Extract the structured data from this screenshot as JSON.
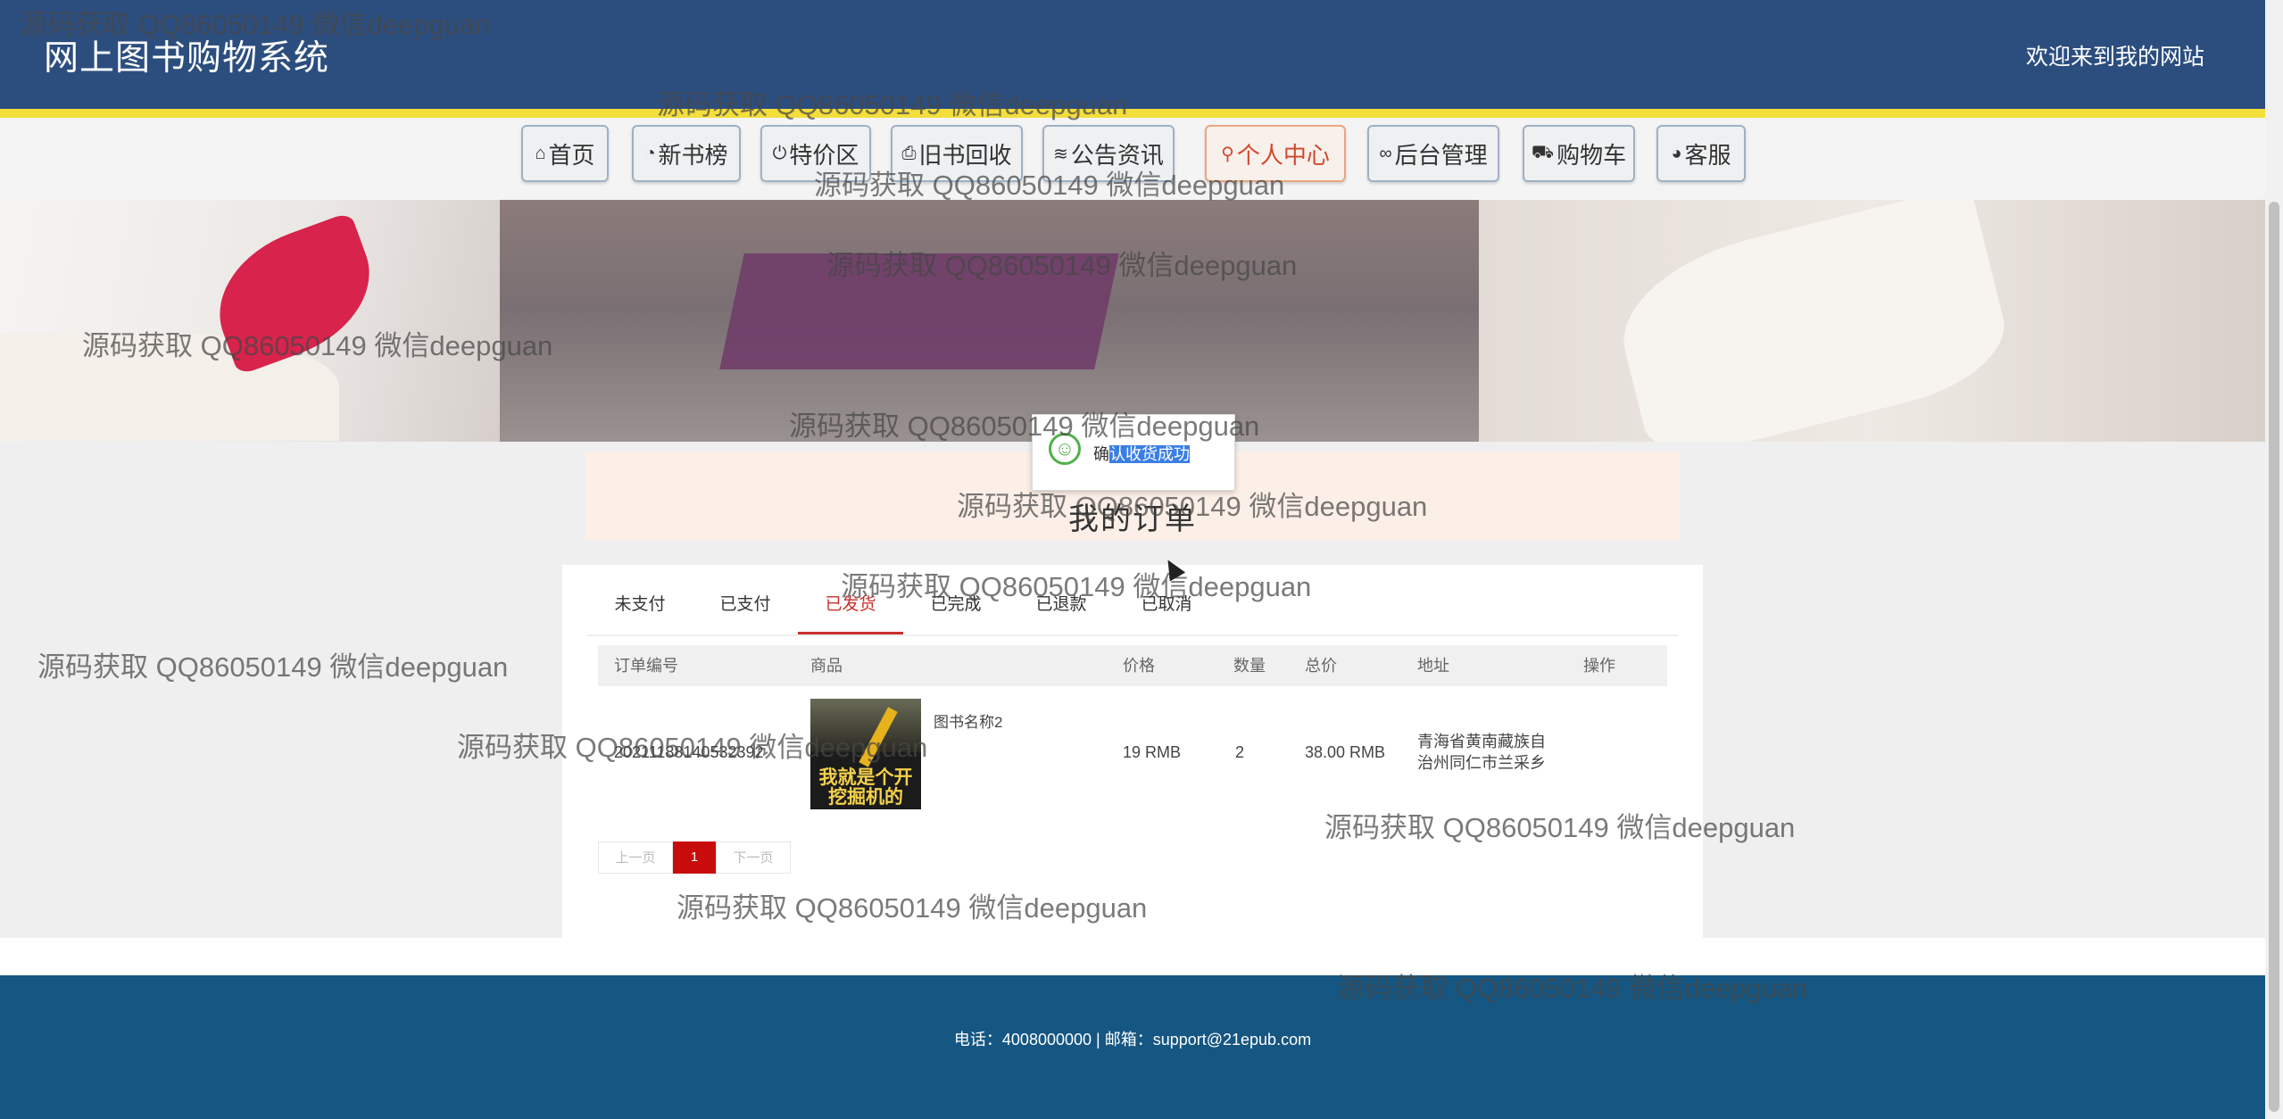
{
  "header": {
    "site_title": "网上图书购物系统",
    "welcome": "欢迎来到我的网站"
  },
  "nav": [
    {
      "icon": "home-icon",
      "glyph": "⌂",
      "label": "首页",
      "active": false
    },
    {
      "icon": "dashboard-icon",
      "glyph": "◔",
      "label": "新书榜",
      "active": false
    },
    {
      "icon": "power-icon",
      "glyph": "⏻",
      "label": "特价区",
      "active": false
    },
    {
      "icon": "printer-icon",
      "glyph": "⎙",
      "label": "旧书回收",
      "active": false
    },
    {
      "icon": "layers-icon",
      "glyph": "≋",
      "label": "公告资讯",
      "active": false
    },
    {
      "icon": "user-icon",
      "glyph": "⚲",
      "label": "个人中心",
      "active": true
    },
    {
      "icon": "link-icon",
      "glyph": "∞",
      "label": "后台管理",
      "active": false
    },
    {
      "icon": "cart-icon",
      "glyph": "⛟",
      "label": "购物车",
      "active": false
    },
    {
      "icon": "chat-icon",
      "glyph": "◕",
      "label": "客服",
      "active": false
    }
  ],
  "toast": {
    "prefix": "确",
    "selected": "认收货成功"
  },
  "page_title": "我的订单",
  "tabs": [
    "未支付",
    "已支付",
    "已发货",
    "已完成",
    "已退款",
    "已取消"
  ],
  "active_tab": "已发货",
  "table": {
    "headers": [
      "订单编号",
      "商品",
      "价格",
      "数量",
      "总价",
      "地址",
      "操作"
    ],
    "rows": [
      {
        "order_no": "20211188140532392",
        "product": "图书名称2",
        "cover_text": "我就是个开挖掘机的",
        "price": "19 RMB",
        "qty": "2",
        "total": "38.00 RMB",
        "address": [
          "青海省黄南藏族自",
          "治州同仁市兰采乡"
        ]
      }
    ]
  },
  "pager": {
    "prev": "上一页",
    "current": "1",
    "next": "下一页"
  },
  "footer": {
    "text": "电话：4008000000 | 邮箱：support@21epub.com"
  },
  "watermark": "源码获取 QQ86050149 微信deepguan",
  "colors": {
    "header": "#2c4e7f",
    "accent_stripe": "#f3de3c",
    "footer": "#155683",
    "active": "#c9302c"
  }
}
